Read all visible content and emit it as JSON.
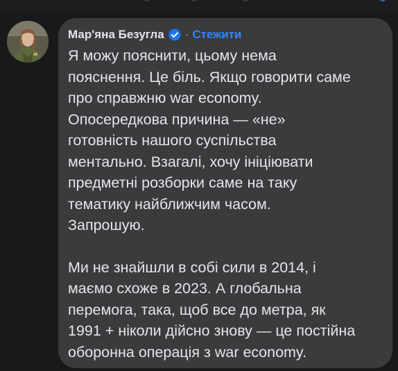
{
  "comment": {
    "author": "Мар'яна Безугла",
    "separator": "·",
    "follow_label": "Стежити",
    "paragraphs": [
      [
        "Я можу пояснити, цьому нема",
        "пояснення. Це біль. Якщо говорити саме",
        "про справжню war economy.",
        "Опосередкова причина — «не»",
        "готовність нашого суспільства",
        "ментально. Взагалі, хочу ініціювати",
        "предметні розборки саме на таку",
        "тематику найближчим часом.",
        "Запрошую."
      ],
      [
        "Ми не знайшли в собі сили в 2014, і",
        "маємо схоже в 2023. А глобальна",
        "перемога, така, щоб все до метра, як",
        "1991 + ніколи дійсно знову — це постійна",
        "оборонна операція з war economy."
      ]
    ]
  },
  "colors": {
    "page_bg": "#18191a",
    "bubble_bg": "#3a3b3c",
    "text": "#e4e6eb",
    "link": "#2d88ff",
    "verified": "#1877f2"
  },
  "icons": {
    "verified": "verified-badge-icon",
    "avatar": "profile-photo"
  }
}
